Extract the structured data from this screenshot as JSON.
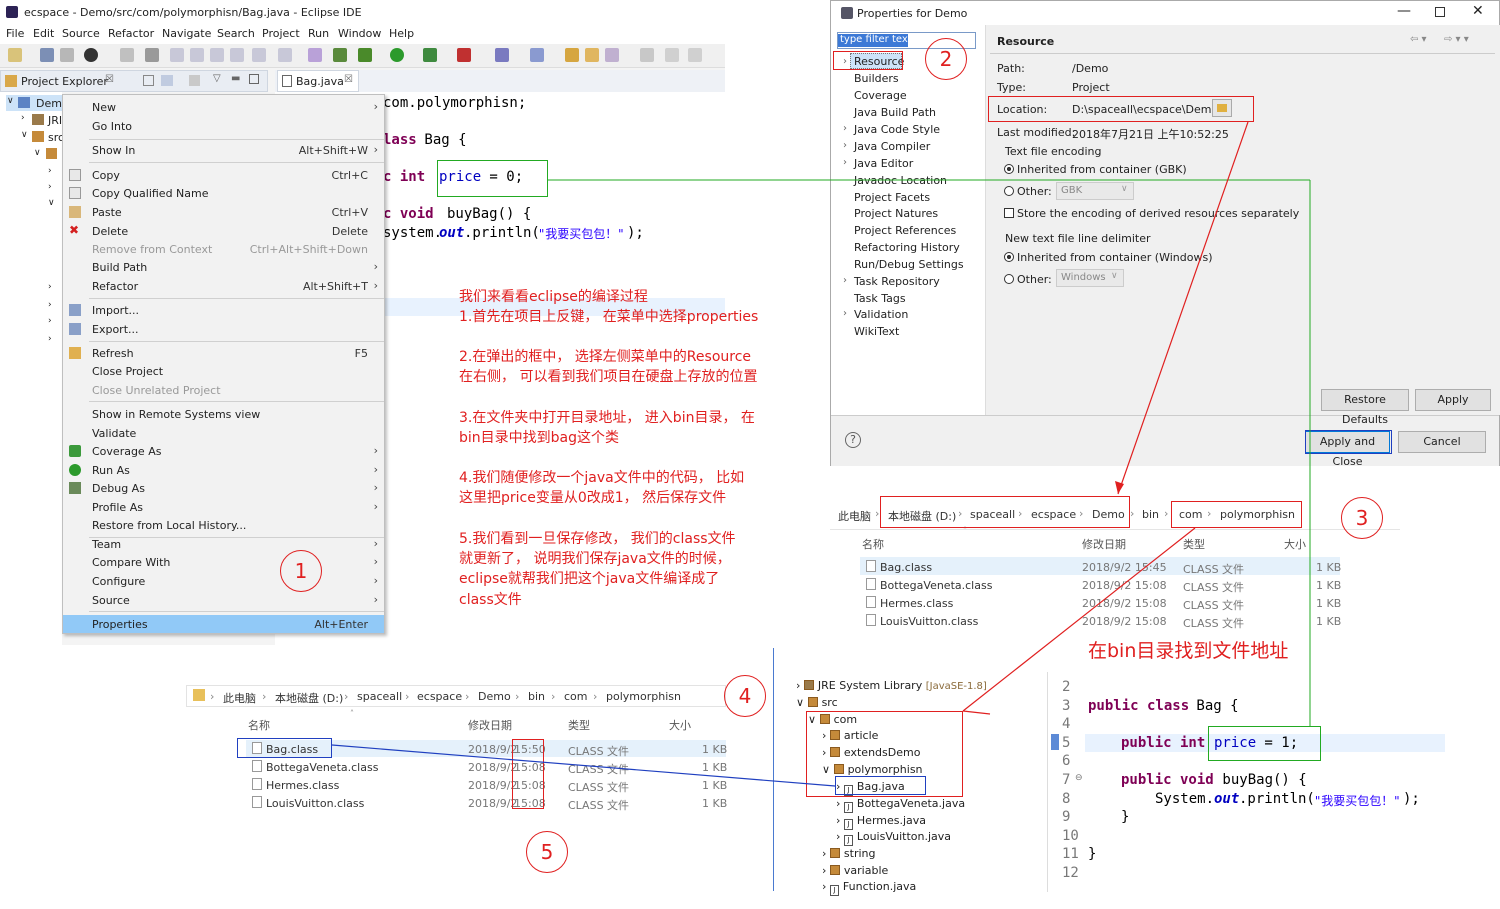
{
  "eclipse": {
    "title": "ecspace - Demo/src/com/polymorphisn/Bag.java - Eclipse IDE",
    "menu": [
      "File",
      "Edit",
      "Source",
      "Refactor",
      "Navigate",
      "Search",
      "Project",
      "Run",
      "Window",
      "Help"
    ],
    "project_explorer_tab": "Project Explorer",
    "editor_tab": "Bag.java",
    "tree": {
      "demo": "Demo",
      "jre": "JRI",
      "src": "src"
    },
    "code": {
      "line1": "com.polymorphisn;",
      "line2_kw": "lass",
      "line2_rest": " Bag {",
      "line3_kw1": "c int ",
      "line3_field": "price",
      "line3_rest": " = 0;",
      "line4_kw": "c void ",
      "line4_rest": "buyBag() {",
      "line5_a": "system.",
      "line5_out": "out",
      "line5_b": ".println(",
      "line5_str": "\"我要买包包！\"",
      "line5_c": ");"
    }
  },
  "context_menu": [
    {
      "label": "New",
      "shortcut": "",
      "arrow": true,
      "disabled": false
    },
    {
      "label": "Go Into",
      "shortcut": "",
      "arrow": false,
      "disabled": false
    },
    {
      "label": "Show In",
      "shortcut": "Alt+Shift+W",
      "arrow": true,
      "disabled": false
    },
    {
      "label": "Copy",
      "shortcut": "Ctrl+C",
      "arrow": false,
      "disabled": false
    },
    {
      "label": "Copy Qualified Name",
      "shortcut": "",
      "arrow": false,
      "disabled": false
    },
    {
      "label": "Paste",
      "shortcut": "Ctrl+V",
      "arrow": false,
      "disabled": false
    },
    {
      "label": "Delete",
      "shortcut": "Delete",
      "arrow": false,
      "disabled": false
    },
    {
      "label": "Remove from Context",
      "shortcut": "Ctrl+Alt+Shift+Down",
      "arrow": false,
      "disabled": true
    },
    {
      "label": "Build Path",
      "shortcut": "",
      "arrow": true,
      "disabled": false
    },
    {
      "label": "Refactor",
      "shortcut": "Alt+Shift+T",
      "arrow": true,
      "disabled": false
    },
    {
      "label": "Import...",
      "shortcut": "",
      "arrow": false,
      "disabled": false
    },
    {
      "label": "Export...",
      "shortcut": "",
      "arrow": false,
      "disabled": false
    },
    {
      "label": "Refresh",
      "shortcut": "F5",
      "arrow": false,
      "disabled": false
    },
    {
      "label": "Close Project",
      "shortcut": "",
      "arrow": false,
      "disabled": false
    },
    {
      "label": "Close Unrelated Project",
      "shortcut": "",
      "arrow": false,
      "disabled": true
    },
    {
      "label": "Show in Remote Systems view",
      "shortcut": "",
      "arrow": false,
      "disabled": false
    },
    {
      "label": "Validate",
      "shortcut": "",
      "arrow": false,
      "disabled": false
    },
    {
      "label": "Coverage As",
      "shortcut": "",
      "arrow": true,
      "disabled": false
    },
    {
      "label": "Run As",
      "shortcut": "",
      "arrow": true,
      "disabled": false
    },
    {
      "label": "Debug As",
      "shortcut": "",
      "arrow": true,
      "disabled": false
    },
    {
      "label": "Profile As",
      "shortcut": "",
      "arrow": true,
      "disabled": false
    },
    {
      "label": "Restore from Local History...",
      "shortcut": "",
      "arrow": false,
      "disabled": false
    },
    {
      "label": "Team",
      "shortcut": "",
      "arrow": true,
      "disabled": false
    },
    {
      "label": "Compare With",
      "shortcut": "",
      "arrow": true,
      "disabled": false
    },
    {
      "label": "Configure",
      "shortcut": "",
      "arrow": true,
      "disabled": false
    },
    {
      "label": "Source",
      "shortcut": "",
      "arrow": true,
      "disabled": false
    },
    {
      "label": "Properties",
      "shortcut": "Alt+Enter",
      "arrow": false,
      "disabled": false
    }
  ],
  "annotations": [
    "我们来看看eclipse的编译过程",
    "1.首先在项目上反键， 在菜单中选择properties",
    "2.在弹出的框中， 选择左侧菜单中的Resource",
    "在右侧， 可以看到我们项目在硬盘上存放的位置",
    "3.在文件夹中打开目录地址， 进入bin目录， 在",
    "bin目录中找到bag这个类",
    "4.我们随便修改一个java文件中的代码， 比如",
    "这里把price变量从0改成1， 然后保存文件",
    "5.我们看到一旦保存修改， 我们的class文件",
    "就更新了， 说明我们保存java文件的时候，",
    "eclipse就帮我们把这个java文件编译成了",
    "class文件"
  ],
  "callout": "在bin目录找到文件地址",
  "circles": [
    "1",
    "2",
    "3",
    "4",
    "5"
  ],
  "properties": {
    "title": "Properties for Demo",
    "filter_placeholder": "type filter text",
    "nav": [
      "Resource",
      "Builders",
      "Coverage",
      "Java Build Path",
      "Java Code Style",
      "Java Compiler",
      "Java Editor",
      "Javadoc Location",
      "Project Facets",
      "Project Natures",
      "Project References",
      "Refactoring History",
      "Run/Debug Settings",
      "Task Repository",
      "Task Tags",
      "Validation",
      "WikiText"
    ],
    "heading": "Resource",
    "path_label": "Path:",
    "path_value": "/Demo",
    "type_label": "Type:",
    "type_value": "Project",
    "location_label": "Location:",
    "location_value": "D:\\spaceall\\ecspace\\Demo",
    "modified_label": "Last modified:",
    "modified_value": "2018年7月21日 上午10:52:25",
    "encoding_title": "Text file encoding",
    "inherited_enc": "Inherited from container (GBK)",
    "other": "Other:",
    "enc_value": "GBK",
    "store_enc": "Store the encoding of derived resources separately",
    "newline_title": "New text file line delimiter",
    "inherited_nl": "Inherited from container (Windows)",
    "nl_value": "Windows",
    "restore_defaults": "Restore Defaults",
    "apply": "Apply",
    "apply_close": "Apply and Close",
    "cancel": "Cancel"
  },
  "explorer1": {
    "crumbs": [
      "此电脑",
      "本地磁盘 (D:)",
      "spaceall",
      "ecspace",
      "Demo",
      "bin",
      "com",
      "polymorphisn"
    ],
    "headers": [
      "名称",
      "修改日期",
      "类型",
      "大小"
    ],
    "rows": [
      {
        "name": "Bag.class",
        "date": "2018/9/2 15:45",
        "type": "CLASS 文件",
        "size": "1 KB"
      },
      {
        "name": "BottegaVeneta.class",
        "date": "2018/9/2 15:08",
        "type": "CLASS 文件",
        "size": "1 KB"
      },
      {
        "name": "Hermes.class",
        "date": "2018/9/2 15:08",
        "type": "CLASS 文件",
        "size": "1 KB"
      },
      {
        "name": "LouisVuitton.class",
        "date": "2018/9/2 15:08",
        "type": "CLASS 文件",
        "size": "1 KB"
      }
    ]
  },
  "explorer2": {
    "crumbs": [
      "此电脑",
      "本地磁盘 (D:)",
      "spaceall",
      "ecspace",
      "Demo",
      "bin",
      "com",
      "polymorphisn"
    ],
    "headers": [
      "名称",
      "修改日期",
      "类型",
      "大小"
    ],
    "rows": [
      {
        "name": "Bag.class",
        "date_a": "2018/9/2",
        "date_b": "15:50",
        "type": "CLASS 文件",
        "size": "1 KB"
      },
      {
        "name": "BottegaVeneta.class",
        "date_a": "2018/9/2",
        "date_b": "15:08",
        "type": "CLASS 文件",
        "size": "1 KB"
      },
      {
        "name": "Hermes.class",
        "date_a": "2018/9/2",
        "date_b": "15:08",
        "type": "CLASS 文件",
        "size": "1 KB"
      },
      {
        "name": "LouisVuitton.class",
        "date_a": "2018/9/2",
        "date_b": "15:08",
        "type": "CLASS 文件",
        "size": "1 KB"
      }
    ]
  },
  "tree2": {
    "jre": "JRE System Library",
    "jre_ver": "[JavaSE-1.8]",
    "items": [
      "src",
      "com",
      "article",
      "extendsDemo",
      "polymorphisn",
      "Bag.java",
      "BottegaVeneta.java",
      "Hermes.java",
      "LouisVuitton.java",
      "string",
      "variable",
      "Function.java"
    ]
  },
  "editor2": {
    "line_numbers": [
      "2",
      "3",
      "4",
      "5",
      "6",
      "7",
      "8",
      "9",
      "10",
      "11",
      "12"
    ],
    "l3_kw": "public class",
    "l3_rest": " Bag {",
    "l5_kw": "public int ",
    "l5_field": "price",
    "l5_rest": " = 1;",
    "l7_kw": "public void",
    "l7_rest": " buyBag() {",
    "l8_a": "System.",
    "l8_out": "out",
    "l8_b": ".println(",
    "l8_str": "\"我要买包包！\"",
    "l8_c": ");",
    "l9": "}",
    "l11": "}"
  }
}
